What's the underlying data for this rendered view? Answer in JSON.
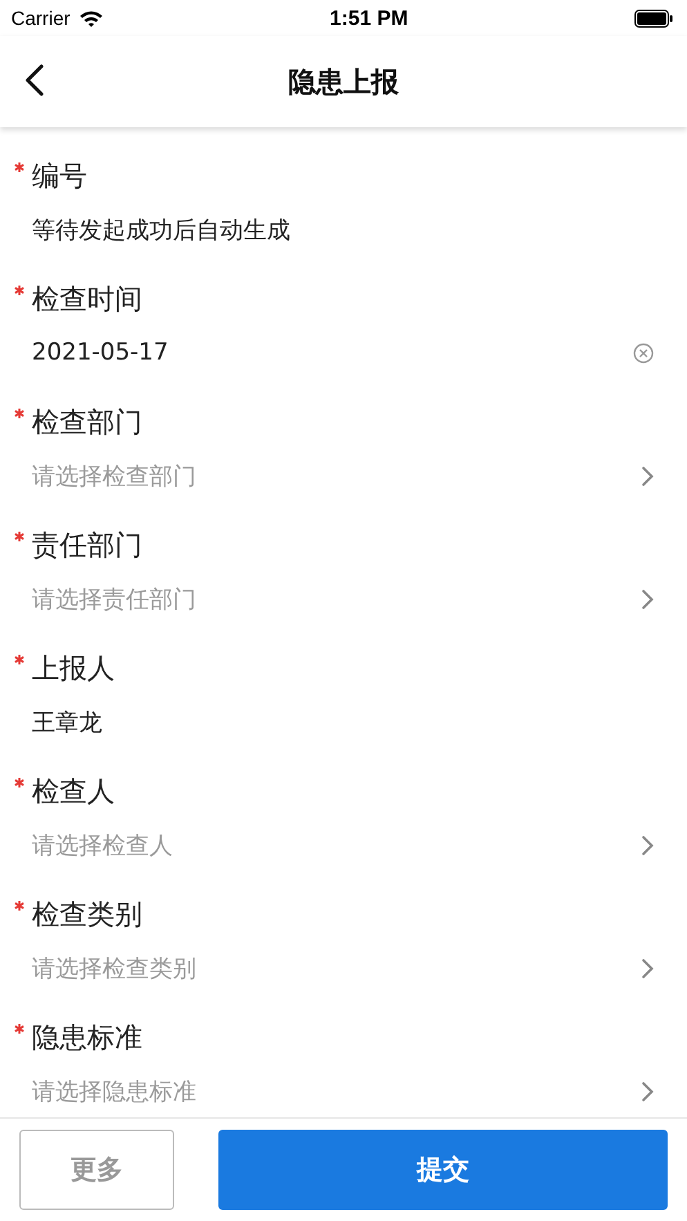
{
  "status_bar": {
    "carrier": "Carrier",
    "time": "1:51 PM"
  },
  "nav": {
    "title": "隐患上报"
  },
  "fields": [
    {
      "label": "编号",
      "required": true,
      "kind": "text",
      "value": "等待发起成功后自动生成"
    },
    {
      "label": "检查时间",
      "required": true,
      "kind": "date",
      "value": "2021-05-17"
    },
    {
      "label": "检查部门",
      "required": true,
      "kind": "select",
      "placeholder": "请选择检查部门"
    },
    {
      "label": "责任部门",
      "required": true,
      "kind": "select",
      "placeholder": "请选择责任部门"
    },
    {
      "label": "上报人",
      "required": true,
      "kind": "text",
      "value": "王章龙"
    },
    {
      "label": "检查人",
      "required": true,
      "kind": "select",
      "placeholder": "请选择检查人"
    },
    {
      "label": "检查类别",
      "required": true,
      "kind": "select",
      "placeholder": "请选择检查类别"
    },
    {
      "label": "隐患标准",
      "required": true,
      "kind": "select",
      "placeholder": "请选择隐患标准"
    }
  ],
  "footer": {
    "more_button": "更多",
    "submit_button": "提交"
  }
}
